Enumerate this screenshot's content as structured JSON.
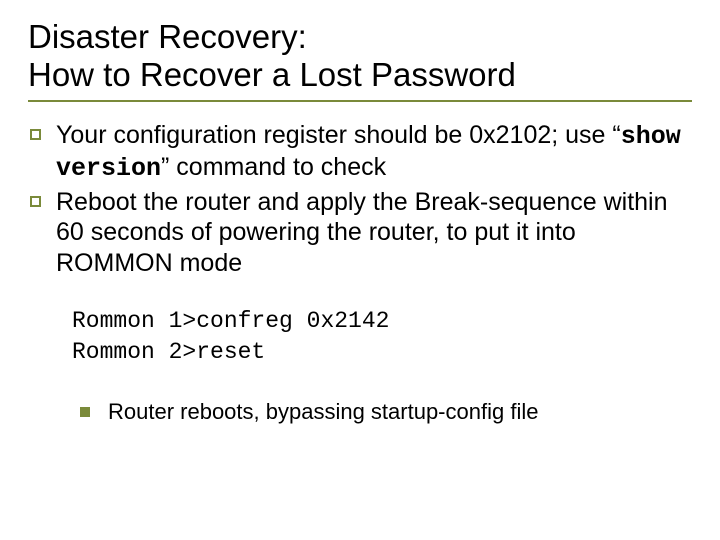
{
  "title": {
    "line1": "Disaster Recovery:",
    "line2": "How to Recover a Lost Password"
  },
  "bullets": [
    {
      "pre": "Your configuration register should be 0x2102; use “",
      "code": "show version",
      "post": "” command to check"
    },
    {
      "text": "Reboot the router and apply the Break-sequence within 60 seconds of powering the router, to put it into ROMMON mode"
    }
  ],
  "code_lines": [
    "Rommon 1>confreg 0x2142",
    "Rommon 2>reset"
  ],
  "sub_bullets": [
    "Router reboots, bypassing startup-config file"
  ]
}
